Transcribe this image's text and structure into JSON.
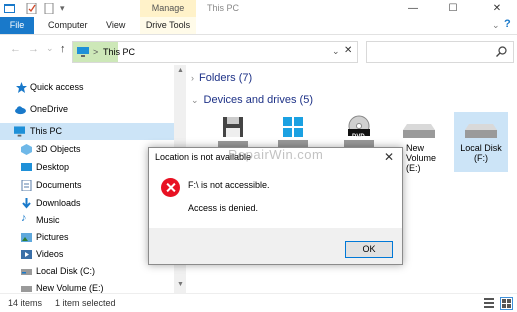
{
  "window": {
    "title": "This PC",
    "manage_tab": "Manage",
    "controls": {
      "minimize": "—",
      "maximize": "☐",
      "close": "✕"
    }
  },
  "ribbon": {
    "tabs": [
      "File",
      "Computer",
      "View",
      "Drive Tools"
    ]
  },
  "address": {
    "path": "This PC",
    "path_sep": ">",
    "clear": "✕"
  },
  "nav_buttons": {
    "back": "←",
    "forward": "→",
    "dropdown": "⌄",
    "up": "↑",
    "refresh_dropdown": "⌄"
  },
  "sidebar": {
    "items": [
      {
        "label": "Quick access",
        "icon": "star-icon"
      },
      {
        "label": "OneDrive",
        "icon": "cloud-icon"
      },
      {
        "label": "This PC",
        "icon": "computer-icon"
      },
      {
        "label": "3D Objects",
        "icon": "cube-icon"
      },
      {
        "label": "Desktop",
        "icon": "desktop-icon"
      },
      {
        "label": "Documents",
        "icon": "documents-icon"
      },
      {
        "label": "Downloads",
        "icon": "download-icon"
      },
      {
        "label": "Music",
        "icon": "music-icon"
      },
      {
        "label": "Pictures",
        "icon": "pictures-icon"
      },
      {
        "label": "Videos",
        "icon": "videos-icon"
      },
      {
        "label": "Local Disk (C:)",
        "icon": "drive-icon"
      },
      {
        "label": "New Volume (E:)",
        "icon": "drive-icon"
      }
    ]
  },
  "content": {
    "folders_header": "Folders (7)",
    "devices_header": "Devices and drives (5)",
    "drives": [
      {
        "label": "",
        "icon": "floppy-drive-icon"
      },
      {
        "label": "",
        "icon": "windows-drive-icon"
      },
      {
        "label": "",
        "icon": "dvd-drive-icon",
        "badge": "DVD"
      },
      {
        "label": "New Volume (E:)",
        "icon": "hard-drive-icon"
      },
      {
        "label": "Local Disk (F:)",
        "icon": "hard-drive-icon"
      }
    ]
  },
  "status": {
    "items": "14 items",
    "selected": "1 item selected"
  },
  "dialog": {
    "title": "Location is not available",
    "message": "F:\\ is not accessible.",
    "detail": "Access is denied.",
    "ok": "OK",
    "close": "✕"
  },
  "watermark": "RepairWin.com",
  "colors": {
    "accent": "#1979ca",
    "selection": "#cce4f7",
    "error": "#e81123",
    "manage_tab": "#fff2c9"
  }
}
